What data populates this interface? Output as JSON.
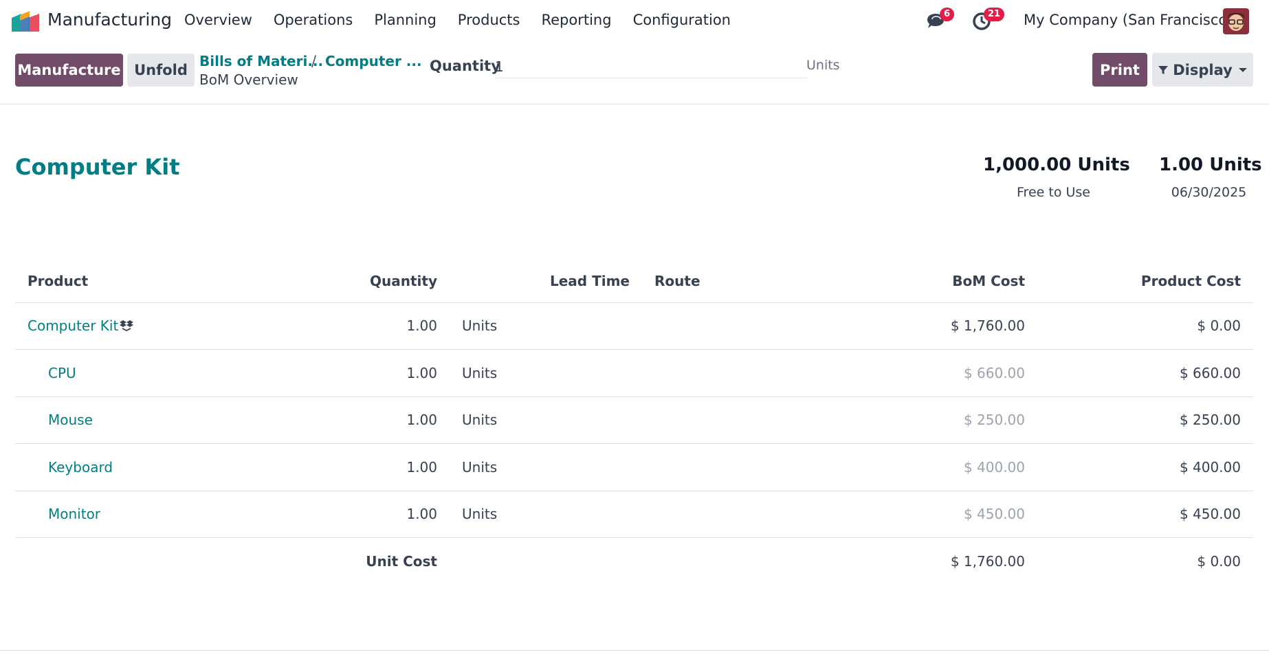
{
  "nav": {
    "app_name": "Manufacturing",
    "menu": [
      "Overview",
      "Operations",
      "Planning",
      "Products",
      "Reporting",
      "Configuration"
    ],
    "messages_count": "6",
    "activities_count": "21",
    "company": "My Company (San Francisco)"
  },
  "control": {
    "manufacture_label": "Manufacture",
    "unfold_label": "Unfold",
    "breadcrumb_1": "Bills of Materi...",
    "breadcrumb_sep": "/",
    "breadcrumb_2": "Computer ...",
    "breadcrumb_current": "BoM Overview",
    "quantity_label": "Quantity",
    "quantity_value": "1",
    "quantity_uom": "Units",
    "print_label": "Print",
    "display_label": "Display"
  },
  "report": {
    "title": "Computer Kit",
    "stat_1_value": "1,000.00 Units",
    "stat_1_label": "Free to Use",
    "stat_2_value": "1.00 Units",
    "stat_2_label": "06/30/2025",
    "headers": {
      "product": "Product",
      "quantity": "Quantity",
      "lead_time": "Lead Time",
      "route": "Route",
      "bom_cost": "BoM Cost",
      "product_cost": "Product Cost"
    },
    "rows": [
      {
        "product": "Computer Kit",
        "qty": "1.00",
        "uom": "Units",
        "bom_cost": "$ 1,760.00",
        "product_cost": "$ 0.00"
      },
      {
        "product": "CPU",
        "qty": "1.00",
        "uom": "Units",
        "bom_cost": "$ 660.00",
        "product_cost": "$ 660.00"
      },
      {
        "product": "Mouse",
        "qty": "1.00",
        "uom": "Units",
        "bom_cost": "$ 250.00",
        "product_cost": "$ 250.00"
      },
      {
        "product": "Keyboard",
        "qty": "1.00",
        "uom": "Units",
        "bom_cost": "$ 400.00",
        "product_cost": "$ 400.00"
      },
      {
        "product": "Monitor",
        "qty": "1.00",
        "uom": "Units",
        "bom_cost": "$ 450.00",
        "product_cost": "$ 450.00"
      }
    ],
    "total": {
      "label": "Unit Cost",
      "bom_cost": "$ 1,760.00",
      "product_cost": "$ 0.00"
    }
  },
  "colors": {
    "brand": "#714B67",
    "link": "#017e84",
    "badge": "#e11d48"
  }
}
